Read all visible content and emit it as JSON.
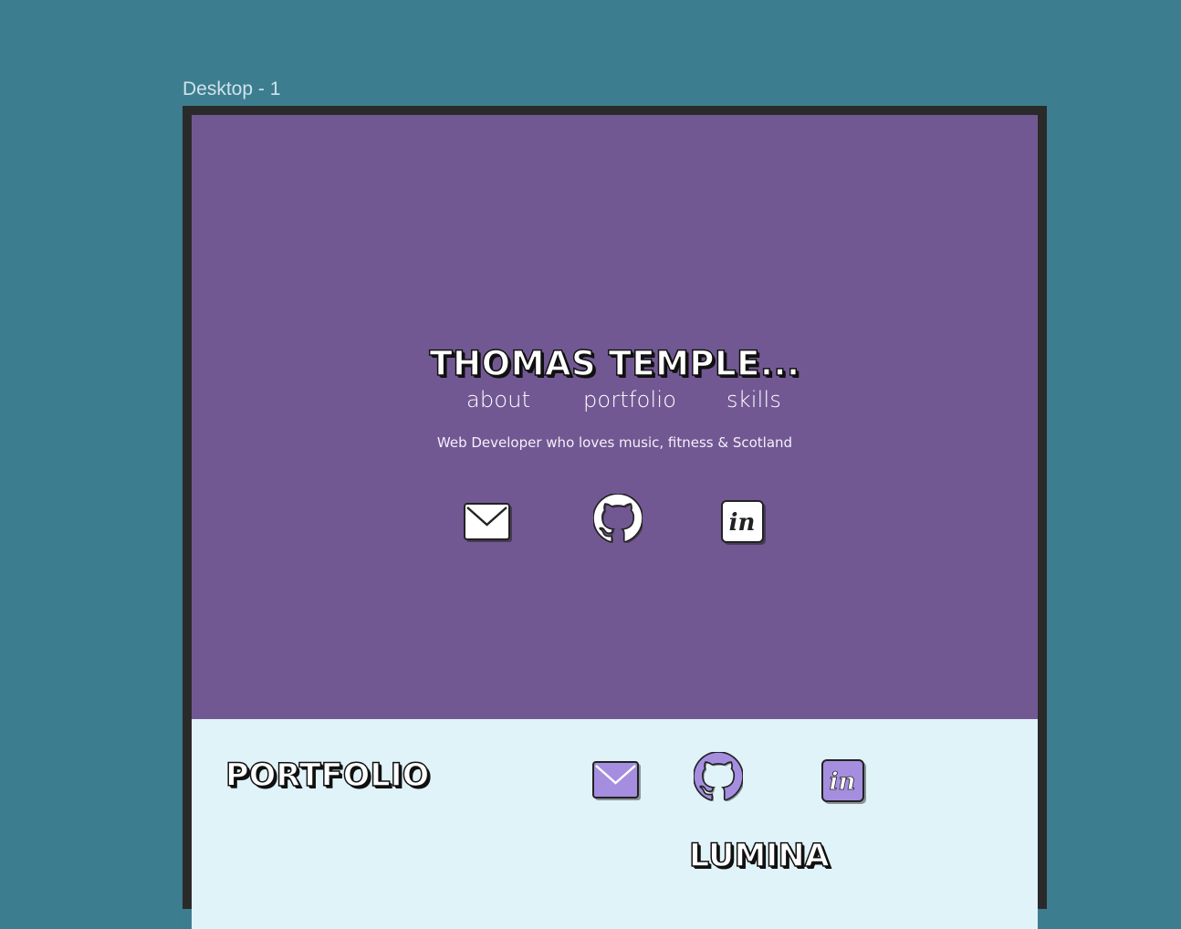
{
  "canvas": {
    "frame_label": "Desktop - 1"
  },
  "nav": {
    "items": [
      "about",
      "portfolio",
      "skills"
    ]
  },
  "hero": {
    "title": "THOMAS TEMPLE...",
    "tagline": "Web Developer who loves music, fitness & Scotland",
    "icons": [
      "mail-icon",
      "github-icon",
      "invision-icon"
    ],
    "background": "#725893"
  },
  "portfolio": {
    "heading": "PORTFOLIO",
    "icons": [
      "mail-icon",
      "github-icon",
      "invision-icon"
    ],
    "project_title": "LUMINA",
    "background": "#e0f3f9",
    "icon_accent": "#a58ee0"
  },
  "colors": {
    "desktop_bg": "#3d7d90",
    "frame_border": "#2a2a2a"
  }
}
